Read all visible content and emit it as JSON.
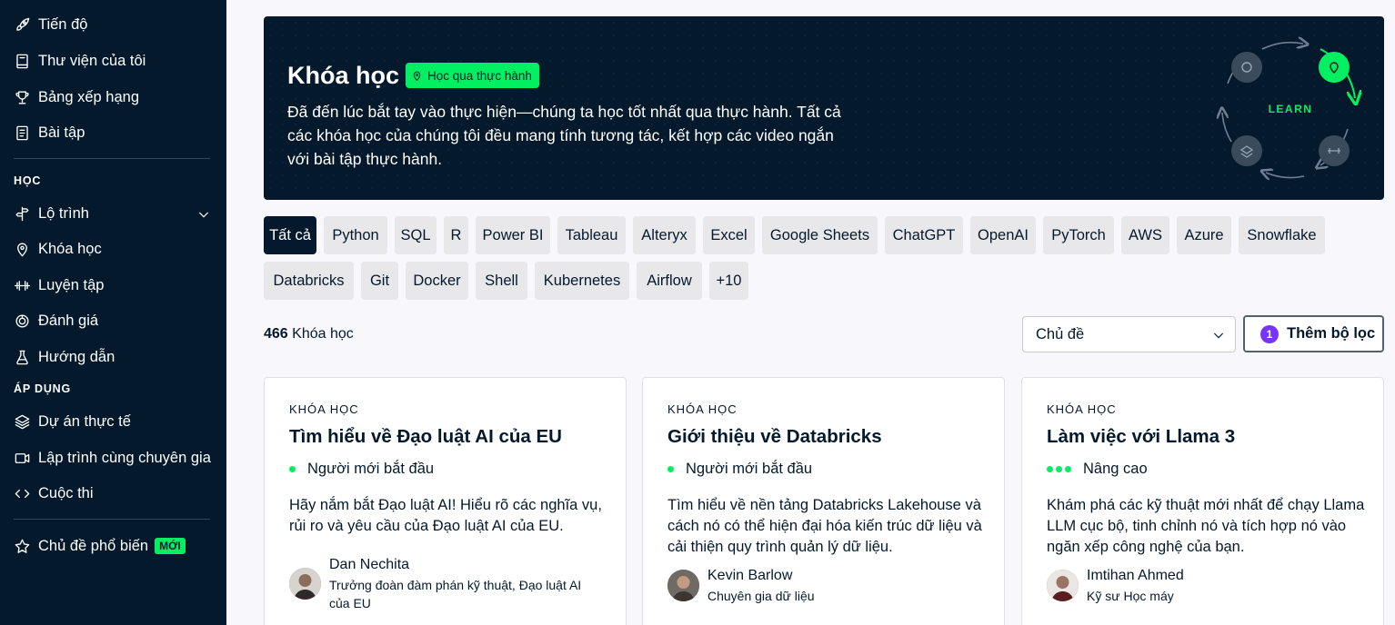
{
  "sidebar": {
    "top_items": [
      {
        "label": "Tiến độ",
        "icon": "rocket-icon"
      },
      {
        "label": "Thư viện của tôi",
        "icon": "book-icon"
      },
      {
        "label": "Bảng xếp hạng",
        "icon": "trophy-icon"
      },
      {
        "label": "Bài tập",
        "icon": "assignment-icon"
      }
    ],
    "learn_section": "HỌC",
    "learn_items": [
      {
        "label": "Lộ trình",
        "icon": "signpost-icon"
      },
      {
        "label": "Khóa học",
        "icon": "map-pin-icon"
      },
      {
        "label": "Luyện tập",
        "icon": "dumbbell-icon"
      },
      {
        "label": "Đánh giá",
        "icon": "gauge-icon"
      },
      {
        "label": "Hướng dẫn",
        "icon": "flask-icon"
      }
    ],
    "apply_section": "ÁP DỤNG",
    "apply_items": [
      {
        "label": "Dự án thực tế",
        "icon": "layers-icon"
      },
      {
        "label": "Lập trình cùng chuyên gia",
        "icon": "video-icon"
      },
      {
        "label": "Cuộc thi",
        "icon": "code-icon"
      }
    ],
    "popular": {
      "label": "Chủ đề phổ biến",
      "badge": "MỚI",
      "icon": "star-icon"
    }
  },
  "hero": {
    "title": "Khóa học",
    "tag": "Học qua thực hành",
    "description": "Đã đến lúc bắt tay vào thực hiện—chúng ta học tốt nhất qua thực hành. Tất cả các khóa học của chúng tôi đều mang tính tương tác, kết hợp các video ngắn với bài tập thực hành.",
    "cycle_label": "LEARN"
  },
  "chips_row1": [
    "Tất cả",
    "Python",
    "SQL",
    "R",
    "Power BI",
    "Tableau",
    "Alteryx",
    "Excel",
    "Google Sheets",
    "ChatGPT",
    "OpenAI",
    "PyTorch",
    "AWS",
    "Azure",
    "Snowflake"
  ],
  "chips_row2": [
    "Databricks",
    "Git",
    "Docker",
    "Shell",
    "Kubernetes",
    "Airflow",
    "+10"
  ],
  "results": {
    "count": "466",
    "count_label": "Khóa học",
    "topic_select": "Chủ đề",
    "filter_count": "1",
    "filter_label": "Thêm bộ lọc"
  },
  "cards": [
    {
      "type": "KHÓA HỌC",
      "title": "Tìm hiểu về Đạo luật AI của EU",
      "level": "Người mới bắt đầu",
      "description": "Hãy nắm bắt Đạo luật AI! Hiểu rõ các nghĩa vụ, rủi ro và yêu cầu của Đạo luật AI của EU.",
      "author": "Dan Nechita",
      "role": "Trưởng đoàn đàm phán kỹ thuật, Đạo luật AI của EU"
    },
    {
      "type": "KHÓA HỌC",
      "title": "Giới thiệu về Databricks",
      "level": "Người mới bắt đầu",
      "description": "Tìm hiểu về nền tảng Databricks Lakehouse và cách nó có thể hiện đại hóa kiến trúc dữ liệu và cải thiện quy trình quản lý dữ liệu.",
      "author": "Kevin Barlow",
      "role": "Chuyên gia dữ liệu"
    },
    {
      "type": "KHÓA HỌC",
      "title": "Làm việc với Llama 3",
      "level": "Nâng cao",
      "description": "Khám phá các kỹ thuật mới nhất để chạy Llama LLM cục bộ, tinh chỉnh nó và tích hợp nó vào ngăn xếp công nghệ của bạn.",
      "author": "Imtihan Ahmed",
      "role": "Kỹ sư Học máy"
    }
  ],
  "colors": {
    "navy": "#05192d",
    "green": "#03ef62",
    "purple": "#7933ff",
    "chip": "#e8e8ea"
  }
}
